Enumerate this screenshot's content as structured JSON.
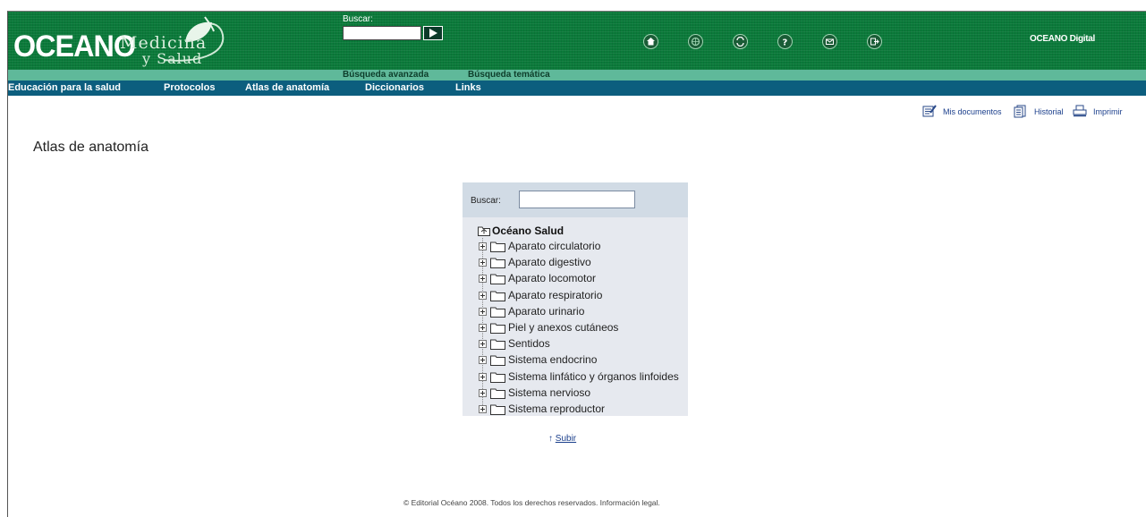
{
  "header": {
    "logo_primary": "OCEANO",
    "logo_line1": "Medicina",
    "logo_line2": "y Salud",
    "search_label": "Buscar:",
    "search_value": "",
    "advanced_search": "Búsqueda avanzada",
    "thematic_search": "Búsqueda temática",
    "brand_right": "OCEANO Digital",
    "icons": [
      "home-icon",
      "globe-icon",
      "refresh-icon",
      "help-icon",
      "mail-icon",
      "exit-icon"
    ]
  },
  "nav": {
    "items": [
      "Educación para la salud",
      "Protocolos",
      "Atlas de anatomía",
      "Diccionarios",
      "Links"
    ],
    "active": "Atlas de anatomía"
  },
  "tools": {
    "my_documents": "Mis documentos",
    "history": "Historial",
    "print": "Imprimir"
  },
  "page": {
    "title": "Atlas de anatomía"
  },
  "tree": {
    "search_label": "Buscar:",
    "search_value": "",
    "root": "Océano Salud",
    "items": [
      "Aparato circulatorio",
      "Aparato digestivo",
      "Aparato locomotor",
      "Aparato respiratorio",
      "Aparato urinario",
      "Piel y anexos cutáneos",
      "Sentidos",
      "Sistema endocrino",
      "Sistema linfático y órganos linfoides",
      "Sistema nervioso",
      "Sistema reproductor"
    ]
  },
  "up_link": {
    "arrow": "↑",
    "label": "Subir"
  },
  "footer": {
    "text": "© Editorial Océano 2008. Todos los derechos reservados. Información legal."
  },
  "colors": {
    "header_green": "#0b7a3a",
    "subbar_green": "#5fb99a",
    "nav_blue": "#0c5e7e",
    "panel_bg": "#e6e9ef",
    "link_blue": "#1b3f8c"
  }
}
